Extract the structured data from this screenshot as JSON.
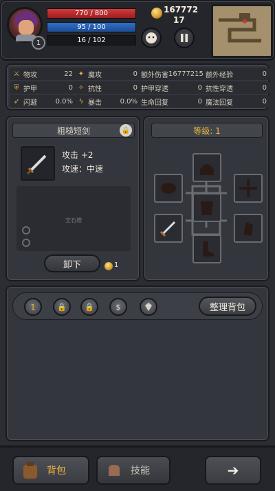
{
  "player": {
    "level": "1",
    "hp": "770 / 800",
    "mp": "95 / 100",
    "exp": "16 / 102",
    "gold": "167772",
    "gems": "17"
  },
  "stats": [
    {
      "icon": "sword-icon",
      "label": "物攻",
      "value": "22"
    },
    {
      "icon": "magic-icon",
      "label": "魔攻",
      "value": "0"
    },
    {
      "icon": "extra-damage-icon",
      "label": "额外伤害",
      "value": "16777215"
    },
    {
      "icon": "extra-exp-icon",
      "label": "额外经验",
      "value": "0"
    },
    {
      "icon": "armor-icon",
      "label": "护甲",
      "value": "0"
    },
    {
      "icon": "resist-icon",
      "label": "抗性",
      "value": "0"
    },
    {
      "icon": "armor-pen-icon",
      "label": "护甲穿透",
      "value": "0"
    },
    {
      "icon": "resist-pen-icon",
      "label": "抗性穿透",
      "value": "0"
    },
    {
      "icon": "dodge-icon",
      "label": "闪避",
      "value": "0.0%"
    },
    {
      "icon": "crit-icon",
      "label": "暴击",
      "value": "0.0%"
    },
    {
      "icon": "hp-regen-icon",
      "label": "生命回复",
      "value": "0"
    },
    {
      "icon": "mp-regen-icon",
      "label": "魔法回复",
      "value": "0"
    }
  ],
  "item": {
    "name": "粗糙短剑",
    "attack": "攻击 +2",
    "speed": "攻速：中速",
    "gem_label": "宝石槽",
    "unequip_label": "卸下",
    "sell_price": "1"
  },
  "equipment": {
    "title": "等级: 1"
  },
  "bag": {
    "count": "1",
    "currency_symbol": "$",
    "sort_label": "整理背包"
  },
  "nav": {
    "bag_label": "背包",
    "skill_label": "技能",
    "next_symbol": "➔"
  },
  "colors": {
    "accent": "#f2b63d",
    "hp": "#c52f31",
    "mp": "#2a62b4"
  }
}
